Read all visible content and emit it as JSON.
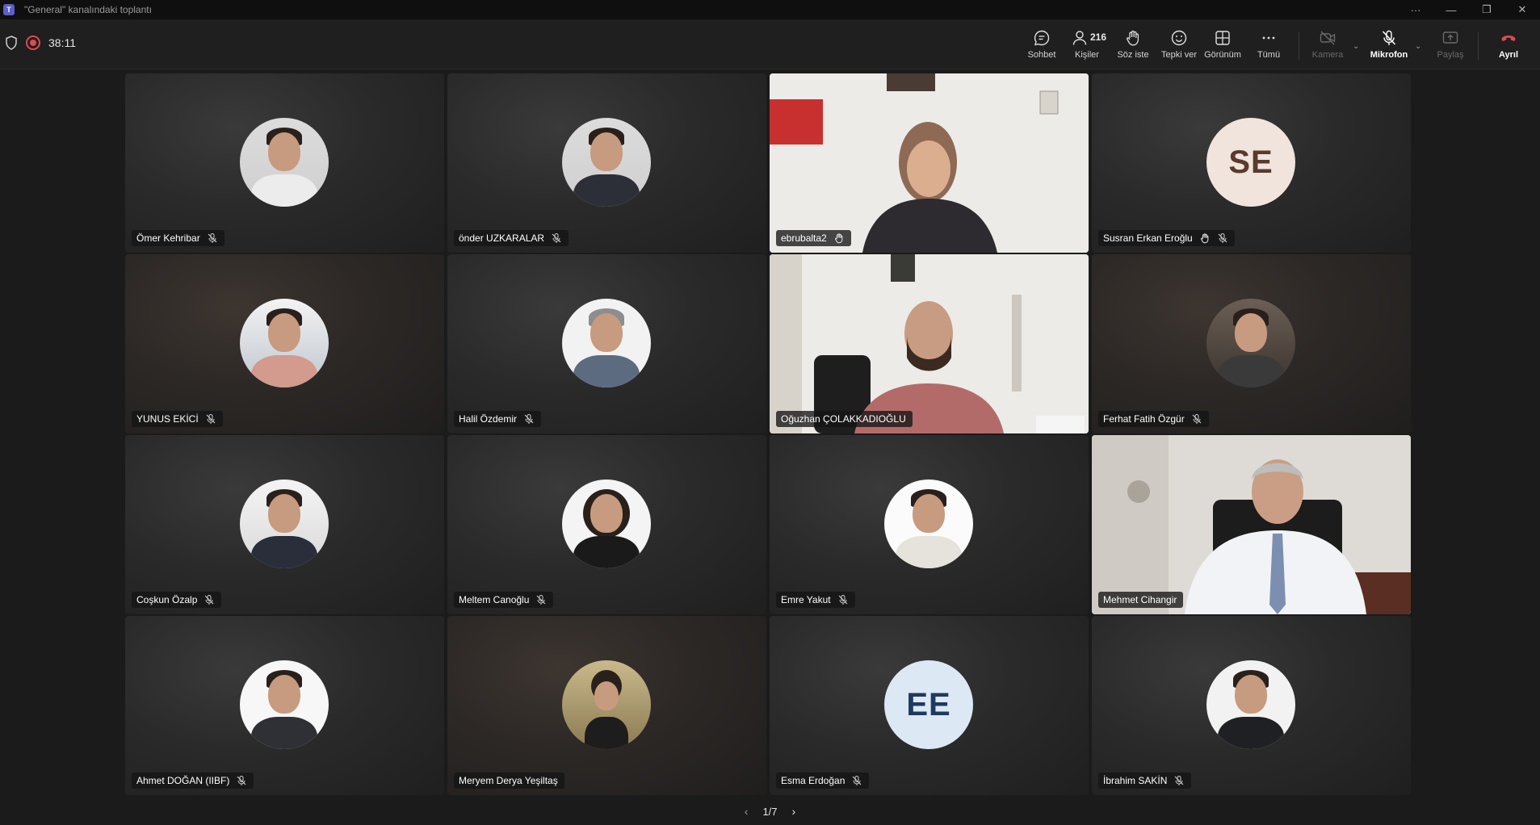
{
  "window": {
    "title": "\"General\" kanalındaki toplantı",
    "controls": [
      "···",
      "—",
      "❐",
      "✕"
    ]
  },
  "meeting": {
    "timer": "38:11"
  },
  "toolbar": {
    "chat_label": "Sohbet",
    "people_label": "Kişiler",
    "people_count": "216",
    "raise_hand_label": "Söz iste",
    "react_label": "Tepki ver",
    "view_label": "Görünüm",
    "more_label": "Tümü",
    "camera_label": "Kamera",
    "mic_label": "Mikrofon",
    "share_label": "Paylaş",
    "leave_label": "Ayrıl"
  },
  "colors": {
    "accent": "#7f85f5",
    "leave": "#e04a4f",
    "se_avatar_bg": "#f0e4dc",
    "se_avatar_fg": "#5a3a2e",
    "ee_avatar_bg": "#dde8f5",
    "ee_avatar_fg": "#1e3a5f"
  },
  "participants": [
    {
      "name": "Ömer Kehribar",
      "muted": true,
      "type": "photo"
    },
    {
      "name": "önder UZKARALAR",
      "muted": true,
      "type": "photo"
    },
    {
      "name": "ebrubalta2",
      "muted": false,
      "type": "video",
      "icon": "raise-hand"
    },
    {
      "name": "Susran Erkan Eroğlu",
      "muted": true,
      "type": "initials",
      "initials": "SE",
      "icon": "raise-hand"
    },
    {
      "name": "YUNUS EKİCİ",
      "muted": true,
      "type": "photo"
    },
    {
      "name": "Halil Özdemir",
      "muted": true,
      "type": "photo"
    },
    {
      "name": "Oğuzhan ÇOLAKKADIOĞLU",
      "muted": false,
      "type": "video",
      "active": true
    },
    {
      "name": "Ferhat Fatih Özgür",
      "muted": true,
      "type": "photo"
    },
    {
      "name": "Coşkun Özalp",
      "muted": true,
      "type": "photo"
    },
    {
      "name": "Meltem Canoğlu",
      "muted": true,
      "type": "photo"
    },
    {
      "name": "Emre Yakut",
      "muted": true,
      "type": "photo"
    },
    {
      "name": "Mehmet Cihangir",
      "muted": false,
      "type": "video"
    },
    {
      "name": "Ahmet DOĞAN (IIBF)",
      "muted": true,
      "type": "photo"
    },
    {
      "name": "Meryem Derya Yeşiltaş",
      "muted": false,
      "type": "photo"
    },
    {
      "name": "Esma Erdoğan",
      "muted": true,
      "type": "initials",
      "initials": "EE"
    },
    {
      "name": "İbrahim SAKİN",
      "muted": true,
      "type": "photo"
    }
  ],
  "pager": {
    "label": "1/7",
    "prev": "‹",
    "next": "›"
  }
}
